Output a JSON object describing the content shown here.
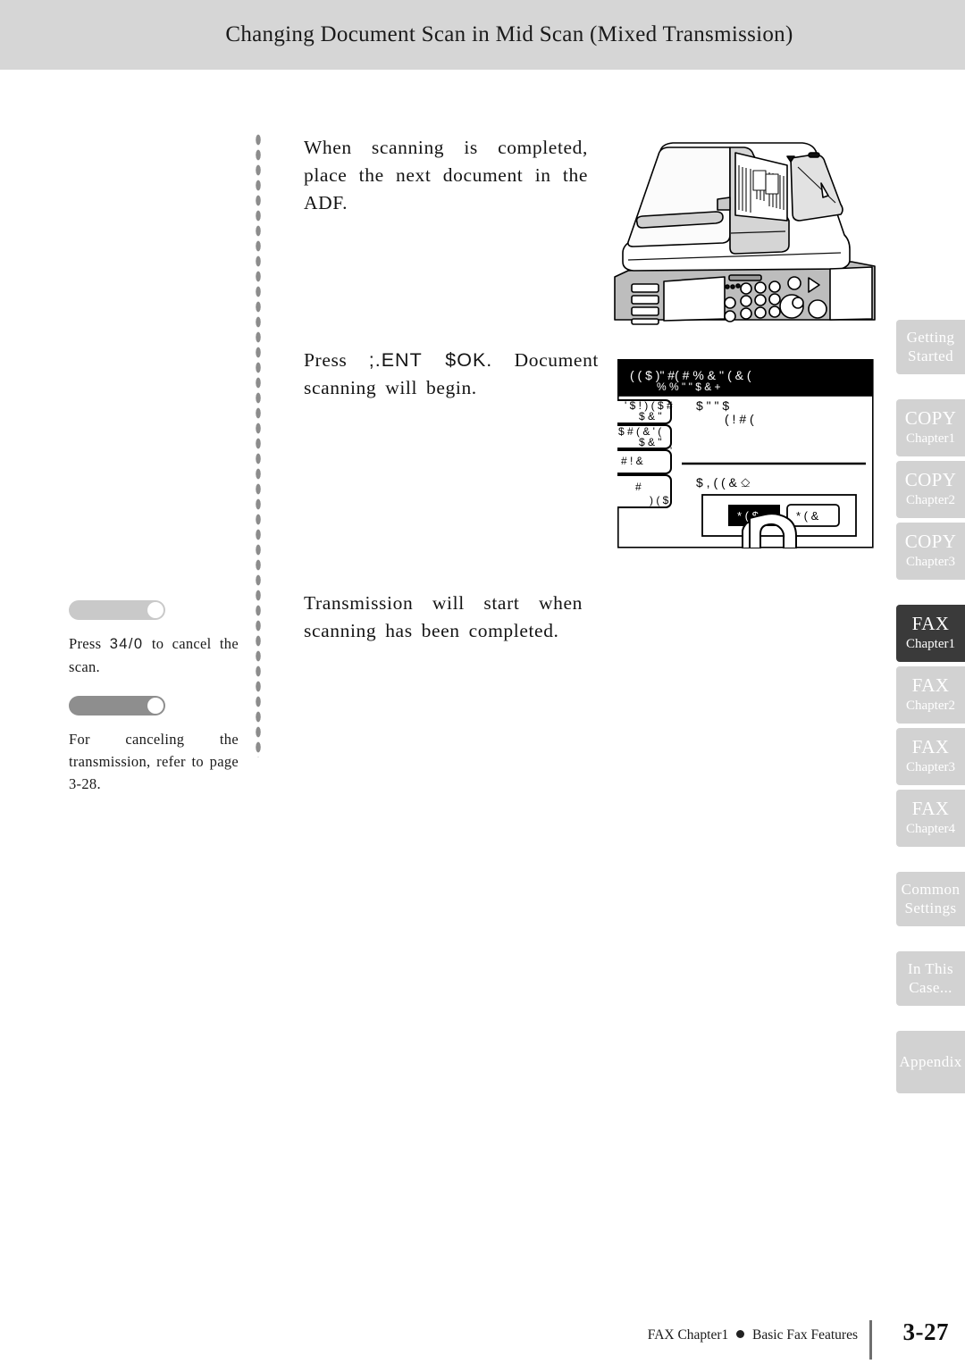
{
  "header": {
    "title": "Changing Document Scan in Mid Scan (Mixed Transmission)",
    "band_color": "#d6d6d6"
  },
  "steps": [
    {
      "id": "step1",
      "text": "When scanning is completed, place the next document in the ADF.",
      "figure": "copier-illustration"
    },
    {
      "id": "step2",
      "text_lead": "Press",
      "text_garbled": ";.ENT $OK.",
      "text_tail": "Document scanning will begin.",
      "figure": "lcd-panel-illustration"
    },
    {
      "id": "step3",
      "text": "Transmission will start when scanning has been completed.",
      "figure": null
    }
  ],
  "notes": [
    {
      "marker_tone": "light",
      "marker_color": "#c9c9c9",
      "lead": "Press",
      "garbled": "34/0",
      "tail": "to cancel the scan."
    },
    {
      "marker_tone": "dark",
      "marker_color": "#8e8e8e",
      "lead": "",
      "garbled": "",
      "tail": "For canceling the transmission, refer to page 3-28."
    }
  ],
  "lcd": {
    "status_bar_line1": "( (      $ )\" #(   #   % & ''     ( & (",
    "status_bar_line2": "%                        % \"          \" $ & +",
    "menu_buttons": [
      "' $ ! ) ( $ #",
      "$ & \"",
      "$ # ( &   ' (",
      "$ & \"",
      "# !  &",
      "#",
      ") ( $"
    ],
    "field_label_1": "$ \" \"    $",
    "field_label_2": "( !  # (",
    "prompt_text": "$       ,      ( (  & ⎐",
    "action_button_selected": "* (    $",
    "action_button_normal": "*      (   &",
    "selected_button_index": 0
  },
  "tabs": [
    {
      "title": "Getting",
      "sub": "Started",
      "active": false,
      "two_line": true,
      "gap_after": "lg"
    },
    {
      "title": "COPY",
      "sub": "Chapter1",
      "active": false,
      "two_line": false,
      "gap_after": "sm"
    },
    {
      "title": "COPY",
      "sub": "Chapter2",
      "active": false,
      "two_line": false,
      "gap_after": "sm"
    },
    {
      "title": "COPY",
      "sub": "Chapter3",
      "active": false,
      "two_line": false,
      "gap_after": "lg"
    },
    {
      "title": "FAX",
      "sub": "Chapter1",
      "active": true,
      "two_line": false,
      "gap_after": "sm"
    },
    {
      "title": "FAX",
      "sub": "Chapter2",
      "active": false,
      "two_line": false,
      "gap_after": "sm"
    },
    {
      "title": "FAX",
      "sub": "Chapter3",
      "active": false,
      "two_line": false,
      "gap_after": "sm"
    },
    {
      "title": "FAX",
      "sub": "Chapter4",
      "active": false,
      "two_line": false,
      "gap_after": "lg"
    },
    {
      "title": "Common",
      "sub": "Settings",
      "active": false,
      "two_line": true,
      "gap_after": "lg"
    },
    {
      "title": "In This",
      "sub": "Case...",
      "active": false,
      "two_line": true,
      "gap_after": "lg"
    },
    {
      "title": "Appendix",
      "sub": "",
      "active": false,
      "two_line": true,
      "gap_after": "lg"
    }
  ],
  "footer": {
    "chapter": "FAX Chapter1",
    "section": "Basic Fax Features",
    "page_number": "3-27"
  }
}
